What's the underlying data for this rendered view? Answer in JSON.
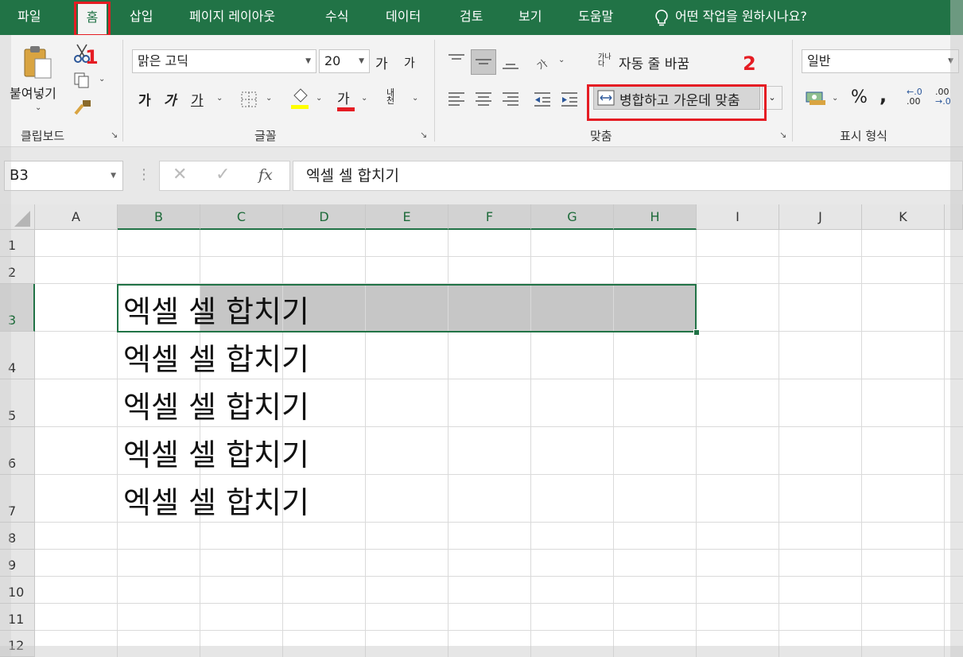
{
  "tabs": [
    "파일",
    "홈",
    "삽입",
    "페이지 레이아웃",
    "수식",
    "데이터",
    "검토",
    "보기",
    "도움말"
  ],
  "tell_me": "어떤 작업을 원하시나요?",
  "markers": {
    "one": "1",
    "two": "2"
  },
  "clipboard": {
    "paste": "붙여넣기",
    "label": "클립보드"
  },
  "font": {
    "name": "맑은 고딕",
    "size": "20",
    "grow": "가",
    "shrink": "가",
    "bold": "가",
    "italic": "가",
    "underline": "가",
    "color_glyph": "가",
    "label": "글꼴",
    "phonetic": "내천"
  },
  "alignment": {
    "wrap": "자동 줄 바꿈",
    "merge": "병합하고 가운데 맞춤",
    "label": "맞춤"
  },
  "number": {
    "format": "일반",
    "percent": "%",
    "comma": ",",
    "inc_dec": ".00",
    "label": "표시 형식"
  },
  "formula_bar": {
    "name_box": "B3",
    "fx": "fx",
    "content": "엑셀 셀 합치기"
  },
  "columns": [
    "A",
    "B",
    "C",
    "D",
    "E",
    "F",
    "G",
    "H",
    "I",
    "J",
    "K"
  ],
  "rows": [
    "1",
    "2",
    "3",
    "4",
    "5",
    "6",
    "7",
    "8",
    "9",
    "10",
    "11",
    "12"
  ],
  "cells": [
    "엑셀 셀 합치기",
    "엑셀 셀 합치기",
    "엑셀 셀 합치기",
    "엑셀 셀 합치기",
    "엑셀 셀 합치기"
  ],
  "colors": {
    "accent": "#217346",
    "highlight": "#e51c23",
    "fill_yellow": "#ffff00",
    "font_red": "#e51c23"
  }
}
